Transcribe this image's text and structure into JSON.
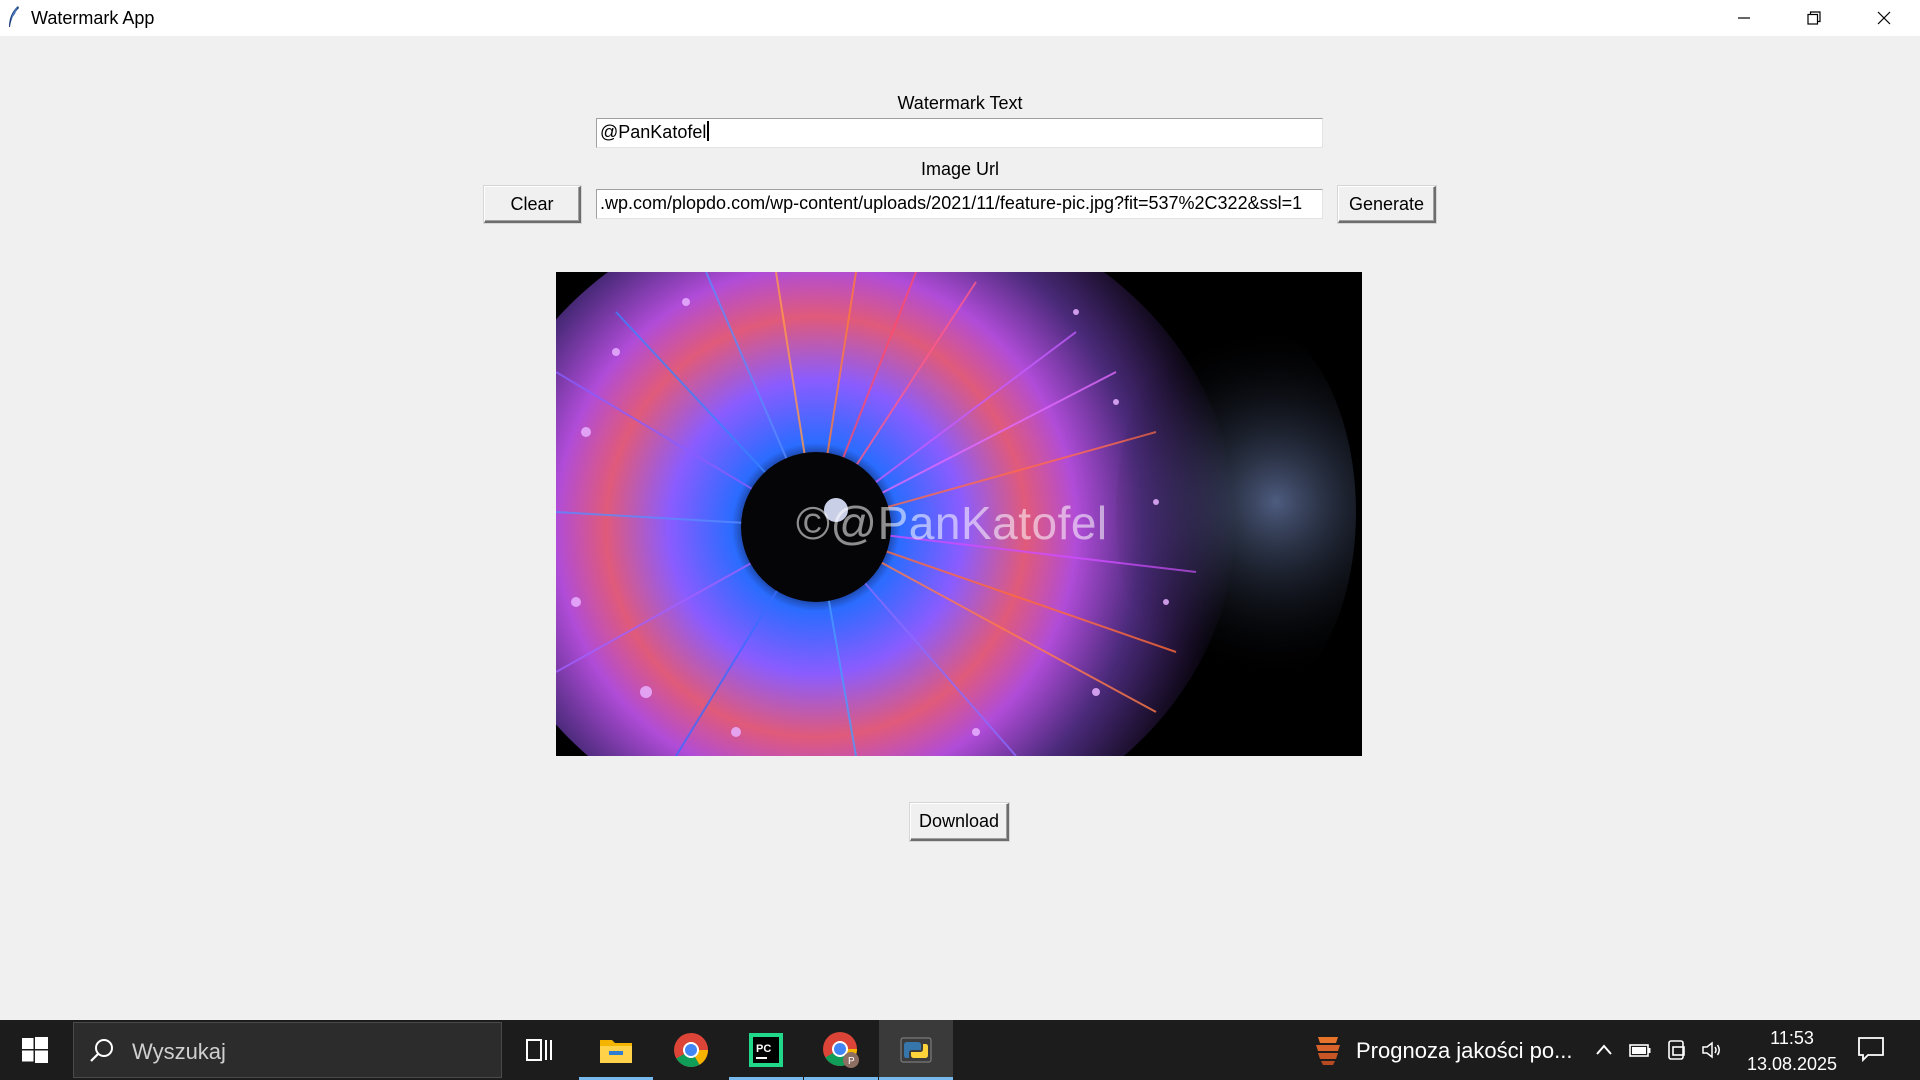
{
  "window": {
    "title": "Watermark App",
    "controls": [
      "minimize-icon",
      "restore-icon",
      "close-icon"
    ]
  },
  "form": {
    "watermark_label": "Watermark Text",
    "watermark_value": "@PanKatofel",
    "url_label": "Image Url",
    "url_value": ".wp.com/plopdo.com/wp-content/uploads/2021/11/feature-pic.jpg?fit=537%2C322&ssl=1",
    "clear_button": "Clear",
    "generate_button": "Generate",
    "download_button": "Download"
  },
  "preview": {
    "watermark_overlay": "©@PanKatofel",
    "image_icon": "colorful-eye-iris-image"
  },
  "taskbar": {
    "search_placeholder": "Wyszukaj",
    "apps": [
      "task-view-icon",
      "file-explorer-icon",
      "chrome-icon",
      "pycharm-icon",
      "chrome-profile-icon",
      "python-icon"
    ],
    "news_text": "Prognoza jakości po...",
    "clock_time": "11:53",
    "clock_date": "13.08.2025"
  },
  "colors": {
    "window_bg": "#f0f0f0",
    "taskbar_bg": "#1c1c1c",
    "accent": "#76b9ed"
  }
}
